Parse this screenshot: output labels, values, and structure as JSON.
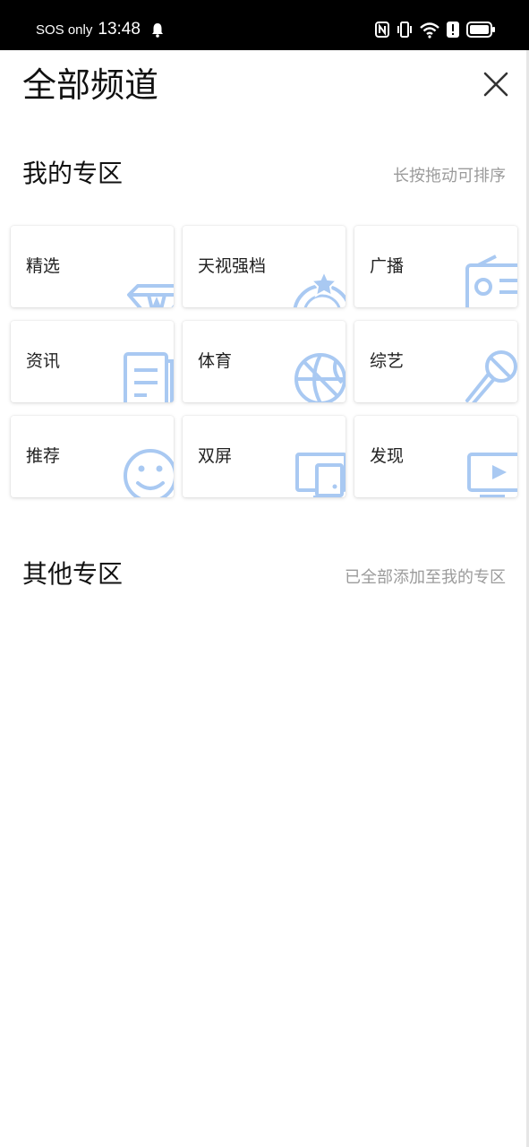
{
  "status_bar": {
    "sos_text": "SOS only",
    "time": "13:48",
    "icons": [
      "bell-icon",
      "nfc-icon",
      "vibrate-icon",
      "wifi-icon",
      "alert-icon",
      "battery-icon"
    ]
  },
  "header": {
    "title": "全部频道",
    "close_icon": "close-icon"
  },
  "my_section": {
    "title": "我的专区",
    "hint": "长按拖动可排序",
    "tiles": [
      {
        "label": "精选",
        "icon": "diamond-icon"
      },
      {
        "label": "天视强档",
        "icon": "star-medal-icon"
      },
      {
        "label": "广播",
        "icon": "radio-icon"
      },
      {
        "label": "资讯",
        "icon": "document-icon"
      },
      {
        "label": "体育",
        "icon": "basketball-icon"
      },
      {
        "label": "综艺",
        "icon": "microphone-icon"
      },
      {
        "label": "推荐",
        "icon": "smiley-icon"
      },
      {
        "label": "双屏",
        "icon": "dual-screen-icon"
      },
      {
        "label": "发现",
        "icon": "video-play-icon"
      }
    ]
  },
  "other_section": {
    "title": "其他专区",
    "hint": "已全部添加至我的专区"
  },
  "colors": {
    "icon_blue": "#a9c9f2",
    "hint_gray": "#9b9b9b",
    "status_bar_bg": "#000000"
  }
}
